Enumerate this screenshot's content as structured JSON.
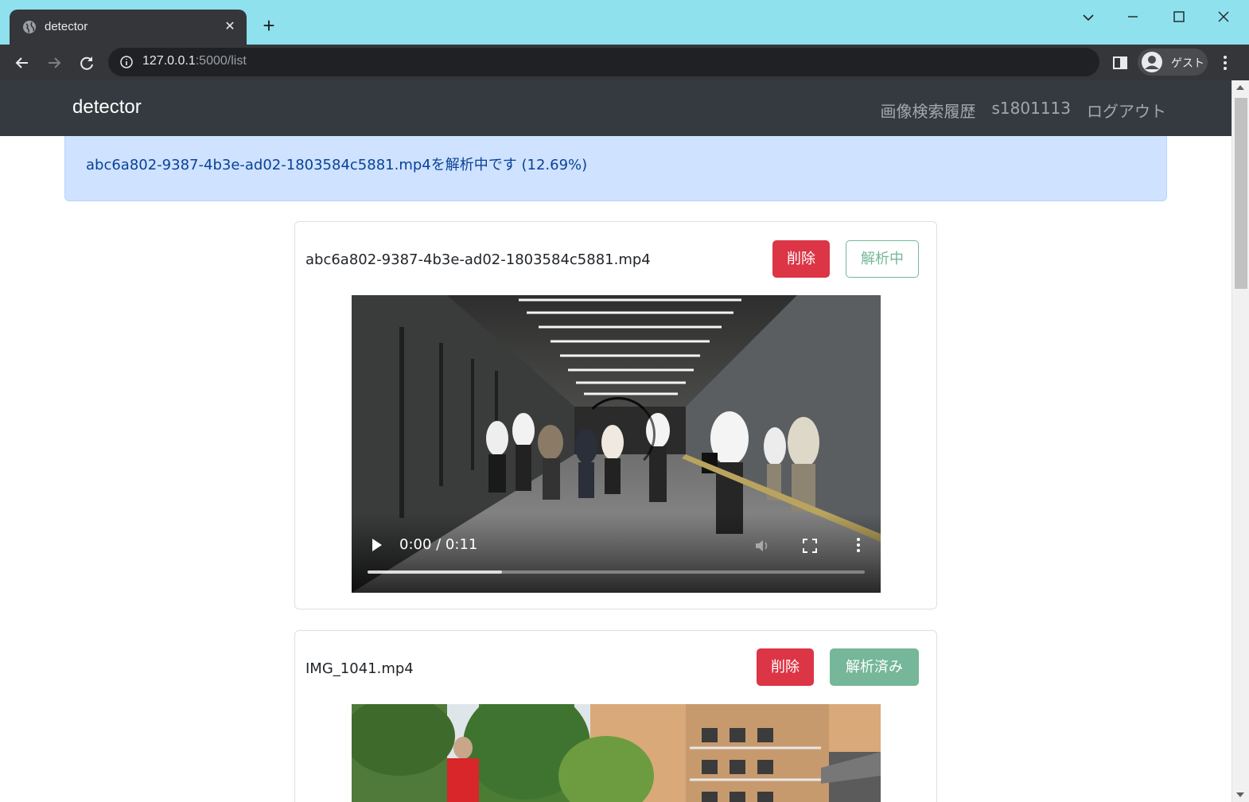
{
  "browser": {
    "tab_title": "detector",
    "tab_close": "✕",
    "new_tab": "+",
    "url_host": "127.0.0.1",
    "url_path": ":5000/list",
    "profile_label": "ゲスト"
  },
  "app": {
    "brand": "detector",
    "nav": {
      "history": "画像検索履歴",
      "user": "s1801113",
      "logout": "ログアウト"
    }
  },
  "alert": {
    "message": "abc6a802-9387-4b3e-ad02-1803584c5881.mp4を解析中です (12.69%)"
  },
  "videos": [
    {
      "filename": "abc6a802-9387-4b3e-ad02-1803584c5881.mp4",
      "delete_label": "削除",
      "status_label": "解析中",
      "status_style": "outline",
      "time": "0:00 / 0:11",
      "buffered": 0.27
    },
    {
      "filename": "IMG_1041.mp4",
      "delete_label": "削除",
      "status_label": "解析済み",
      "status_style": "solid"
    }
  ],
  "colors": {
    "titlebar": "#8fe1ee",
    "navbar": "#343a40",
    "alert_bg": "#cfe2ff",
    "danger": "#dc3545",
    "success": "#75b798"
  }
}
